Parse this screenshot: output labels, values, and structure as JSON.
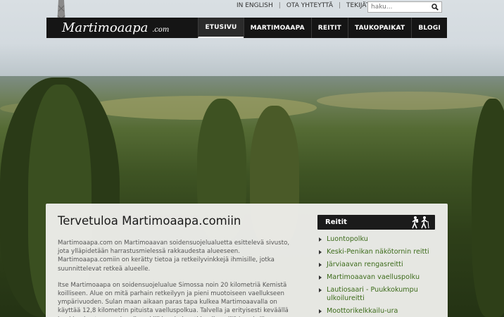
{
  "header": {
    "links": [
      "IN ENGLISH",
      "OTA YHTEYTTÄ",
      "TEKIJÄT"
    ],
    "separator": "|",
    "search_placeholder": "haku..."
  },
  "logo": {
    "main": "Martimoaapa",
    "suffix": ".com"
  },
  "nav": {
    "items": [
      "ETUSIVU",
      "MARTIMOAAPA",
      "REITIT",
      "TAUKOPAIKAT",
      "BLOGI"
    ],
    "active": "ETUSIVU"
  },
  "main": {
    "title": "Tervetuloa Martimoaapa.comiin",
    "paragraphs": [
      "Martimoaapa.com on Martimoaavan soidensuojelualuetta esittelevä sivusto, jota ylläpidetään harrastusmielessä rakkaudesta alueeseen. Martimoaapa.comiin on kerätty tietoa ja retkeilyvinkkejä ihmisille, jotka suunnittelevat retkeä alueelle.",
      "Itse Martimoaapa on soidensuojelualue Simossa noin 20 kilometriä Kemistä koilliseen. Alue on mitä parhain retkeilyyn ja pieni muotoiseen vaellukseen ympärivuoden. Sulan maan aikaan paras tapa kulkea Martimoaavalla on käyttää 12,8 kilometrin pituista vaelluspolkua. Talvella ja erityisesti keväällä hankien kantaessa alueella voi liikkua helposti lumikengillä ja suksilla."
    ]
  },
  "sidebar": {
    "title": "Reitit",
    "icon": "hikers-icon",
    "items": [
      "Luontopolku",
      "Keski-Penikan näkötornin reitti",
      "Järviaavan rengasreitti",
      "Martimoaavan vaelluspolku",
      "Lautiosaari - Puukkokumpu ulkoilureitti",
      "Moottorikelkkailu-ura"
    ]
  },
  "colors": {
    "nav_bg": "#151515",
    "link_green": "#3c6b1a",
    "panel_bg": "#eeeeeb"
  }
}
